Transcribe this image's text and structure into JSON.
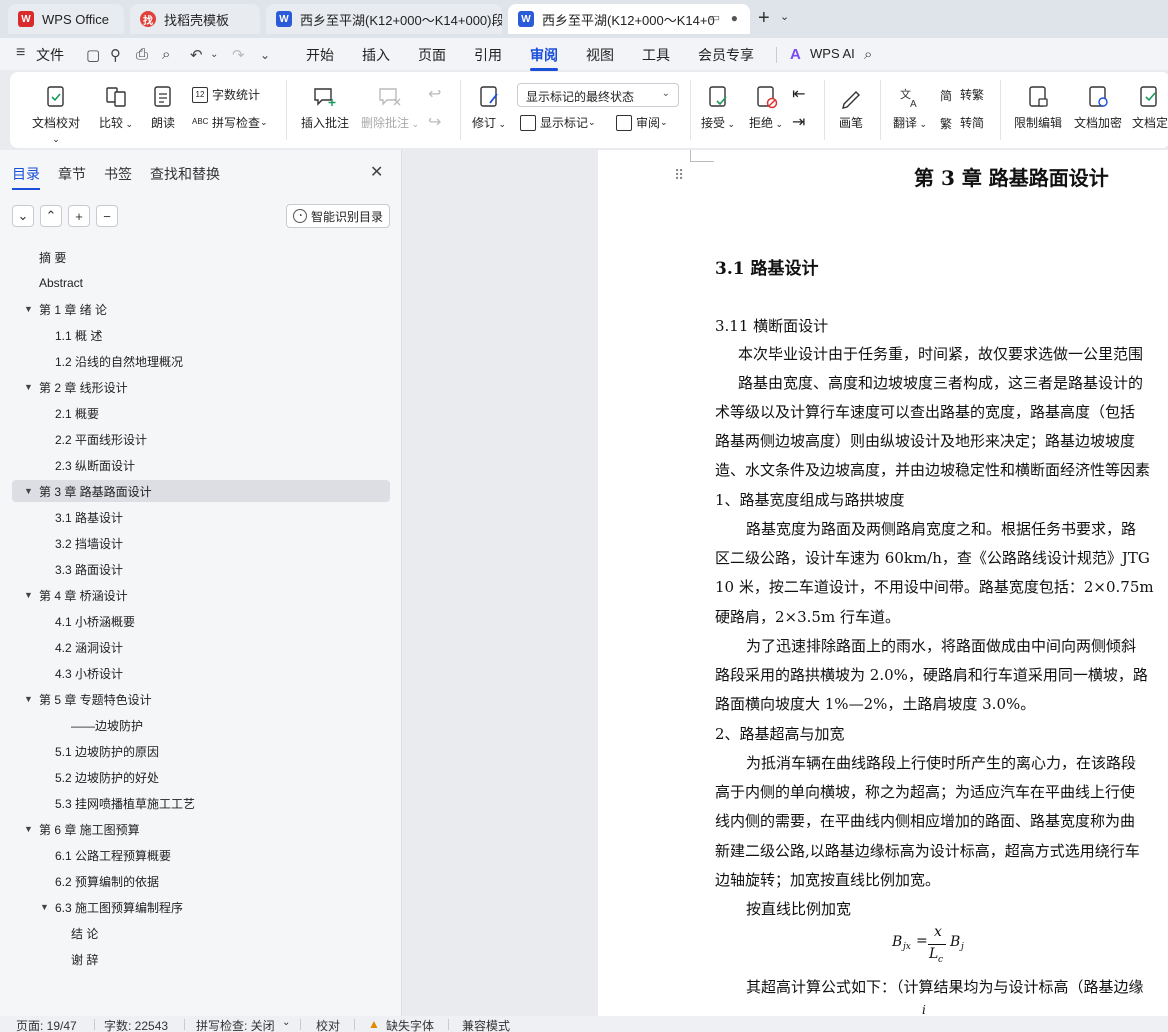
{
  "tabs": [
    {
      "label": "WPS Office"
    },
    {
      "label": "找稻壳模板"
    },
    {
      "label": "西乡至平湖(K12+000～K14+000)段"
    },
    {
      "label": "西乡至平湖(K12+000～K14+0"
    }
  ],
  "menu": {
    "file": "文件",
    "items": [
      "开始",
      "插入",
      "页面",
      "引用",
      "审阅",
      "视图",
      "工具",
      "会员专享"
    ],
    "wps_ai": "WPS AI"
  },
  "ribbon": {
    "doc_check": "文档校对",
    "compare": "比较",
    "read_aloud": "朗读",
    "word_count": "字数统计",
    "spell_check": "拼写检查",
    "insert_comment": "插入批注",
    "delete_comment": "删除批注",
    "track_changes": "修订",
    "markup_select": "显示标记的最终状态",
    "show_markup": "显示标记",
    "review": "审阅",
    "accept": "接受",
    "reject": "拒绝",
    "pen": "画笔",
    "translate": "翻译",
    "to_traditional": "转繁",
    "to_simplified": "转简",
    "restrict_edit": "限制编辑",
    "encrypt": "文档加密",
    "doc_final": "文档定"
  },
  "panel": {
    "tabs": [
      "目录",
      "章节",
      "书签",
      "查找和替换"
    ],
    "smart_toc": "智能识别目录",
    "toc": [
      {
        "label": "摘 要"
      },
      {
        "label": "Abstract"
      },
      {
        "label": "第 1 章  绪  论"
      },
      {
        "label": "1.1     概     述"
      },
      {
        "label": "1.2     沿线的自然地理概况"
      },
      {
        "label": "第 2 章  线形设计"
      },
      {
        "label": "2.1 概要"
      },
      {
        "label": "2.2 平面线形设计"
      },
      {
        "label": "2.3  纵断面设计"
      },
      {
        "label": "第 3 章  路基路面设计"
      },
      {
        "label": "3.1  路基设计"
      },
      {
        "label": "3.2    挡墙设计"
      },
      {
        "label": "3.3     路面设计"
      },
      {
        "label": "第 4 章  桥涵设计"
      },
      {
        "label": "4.1 小桥涵概要"
      },
      {
        "label": "4.2 涵洞设计"
      },
      {
        "label": "4.3 小桥设计"
      },
      {
        "label": "第 5 章     专题特色设计"
      },
      {
        "label": "——边坡防护"
      },
      {
        "label": "5.1 边坡防护的原因"
      },
      {
        "label": "5.2 边坡防护的好处"
      },
      {
        "label": "5.3 挂网喷播植草施工工艺"
      },
      {
        "label": "第 6 章  施工图预算"
      },
      {
        "label": "6.1 公路工程预算概要"
      },
      {
        "label": "6.2 预算编制的依据"
      },
      {
        "label": "6.3 施工图预算编制程序"
      },
      {
        "label": "结  论"
      },
      {
        "label": "谢  辞"
      }
    ]
  },
  "doc": {
    "chapter_title": "第 3 章  路基路面设计",
    "section_title": "3.1  路基设计",
    "subsection": "3.11 横断面设计",
    "lines": [
      "本次毕业设计由于任务重，时间紧，故仅要求选做一公里范围",
      "路基由宽度、高度和边坡坡度三者构成，这三者是路基设计的",
      "术等级以及计算行车速度可以查出路基的宽度，路基高度（包括",
      "路基两侧边坡高度）则由纵坡设计及地形来决定；路基边坡坡度",
      "造、水文条件及边坡高度，并由边坡稳定性和横断面经济性等因素",
      "1、路基宽度组成与路拱坡度",
      "路基宽度为路面及两侧路肩宽度之和。根据任务书要求，路",
      "区二级公路，设计车速为 60km/h，查《公路路线设计规范》JTG",
      "10 米，按二车道设计，不用设中间带。路基宽度包括：2×0.75m",
      "硬路肩，2×3.5m 行车道。",
      "为了迅速排除路面上的雨水，将路面做成由中间向两侧倾斜",
      "路段采用的路拱横坡为 2.0%，硬路肩和行车道采用同一横坡，路",
      "路面横向坡度大 1%—2%，土路肩坡度 3.0%。",
      "2、路基超高与加宽",
      "为抵消车辆在曲线路段上行使时所产生的离心力，在该路段",
      "高于内侧的单向横坡，称之为超高；为适应汽车在平曲线上行使",
      "线内侧的需要，在平曲线内侧相应增加的路面、路基宽度称为曲",
      "新建二级公路,以路基边缘标高为设计标高，超高方式选用绕行车",
      "边轴旋转；加宽按直线比例加宽。",
      "按直线比例加宽",
      "其超高计算公式如下：（计算结果均为与设计标高（路基边缘"
    ],
    "formula": {
      "lhs": "B",
      "lhs_sub": "jx",
      "num": "x",
      "den": "L",
      "den_sub": "c",
      "rhs": "B",
      "rhs_sub": "j"
    },
    "formula_cut": "i"
  },
  "status": {
    "page": "页面: 19/47",
    "words": "字数: 22543",
    "spell": "拼写检查: 关闭",
    "proof": "校对",
    "missing_font": "缺失字体",
    "compat": "兼容模式"
  },
  "colors": {
    "accent": "#1b4fd8",
    "wps_red": "#d92b2b",
    "word_blue": "#2b5bd8"
  }
}
